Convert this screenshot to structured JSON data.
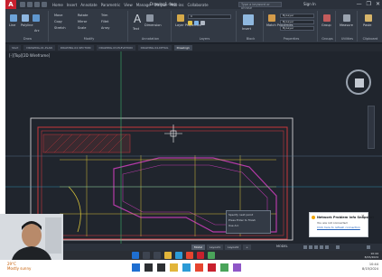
{
  "window": {
    "app_logo": "A",
    "title": "Drawing1.dwg",
    "search_placeholder": "Type a keyword or phrase",
    "user": "Sign In",
    "controls": [
      "—",
      "❐",
      "✕"
    ]
  },
  "ribbon": {
    "tabs": [
      "Home",
      "Insert",
      "Annotate",
      "Parametric",
      "View",
      "Manage",
      "Output",
      "Add-ins",
      "Collaborate",
      "Express Tools",
      "Featured Apps"
    ],
    "panels": [
      "Draw",
      "Modify",
      "Annotation",
      "Layers",
      "Block",
      "Properties",
      "Groups",
      "Utilities",
      "Clipboard",
      "View"
    ],
    "tools": {
      "line": "Line",
      "polyline": "Polyline",
      "circle": "Circle",
      "arc": "Arc",
      "move": "Move",
      "rotate": "Rotate",
      "trim": "Trim",
      "copy": "Copy",
      "mirror": "Mirror",
      "fillet": "Fillet",
      "stretch": "Stretch",
      "scale": "Scale",
      "array": "Array",
      "text": "Text",
      "dimension": "Dimension",
      "layer_properties": "Layer Properties",
      "insert": "Insert",
      "match_properties": "Match Properties",
      "group": "Group",
      "measure": "Measure",
      "paste": "Paste",
      "base": "Base"
    },
    "combos": {
      "layer": "0",
      "color": "ByLayer",
      "linetype": "ByLayer",
      "lineweight": "ByLayer"
    }
  },
  "file_tabs": [
    "Start",
    "DRAWING-01-PLAN",
    "DRAWING-02-SECTION",
    "DRAWING-03-ELEVATION",
    "DRAWING-04-DETAIL",
    "Drawing1"
  ],
  "canvas": {
    "view_label": "[-][Top][2D Wireframe]",
    "tooltip_lines": [
      "Specify next point",
      "Press Enter to finish",
      "Use Arc"
    ]
  },
  "statusbar": {
    "layout_tabs": [
      "Model",
      "Layout1",
      "Layout2",
      "+"
    ],
    "model_label": "MODEL"
  },
  "toast": {
    "title": "Network Problem Info Snapshot",
    "body": "You are not connected",
    "link": "Click here to refresh connection"
  },
  "taskbar": {
    "weather": "29°C",
    "weather_desc": "Mostly sunny",
    "time": "10:44",
    "date": "8/15/2024"
  },
  "colors": {
    "drawing_red": "#c8363c",
    "drawing_magenta": "#b53aa8",
    "drawing_yellow": "#d6c23a",
    "axis_green": "#3fb36a",
    "axis_cyan": "#35a7c7"
  }
}
